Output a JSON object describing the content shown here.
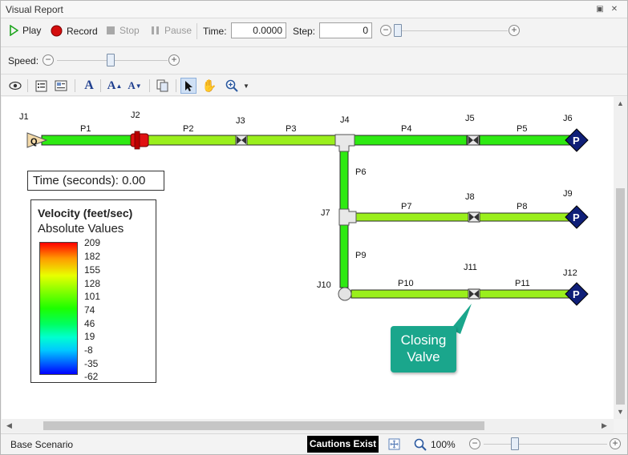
{
  "window": {
    "title": "Visual Report"
  },
  "playback": {
    "play_label": "Play",
    "record_label": "Record",
    "stop_label": "Stop",
    "pause_label": "Pause",
    "time_label": "Time:",
    "time_value": "0.0000",
    "step_label": "Step:",
    "step_value": "0",
    "speed_label": "Speed:",
    "step_slider_level": 0.0,
    "speed_slider_level": 0.5
  },
  "toolbar": {
    "icons": [
      "eye-icon",
      "list-icon",
      "card-icon",
      "font-icon",
      "font-grow-icon",
      "font-shrink-icon",
      "copy-icon",
      "pointer-icon",
      "pan-hand-icon",
      "zoom-icon",
      "dropdown-arrow-icon"
    ],
    "font_glyph": "A"
  },
  "diagram": {
    "junctions": [
      "J1",
      "J2",
      "J3",
      "J4",
      "J5",
      "J6",
      "J7",
      "J8",
      "J9",
      "J10",
      "J11",
      "J12"
    ],
    "pipes": [
      "P1",
      "P2",
      "P3",
      "P4",
      "P5",
      "P6",
      "P7",
      "P8",
      "P9",
      "P10",
      "P11"
    ],
    "source_symbol": "Q",
    "pressure_symbol": "P",
    "time_text": "Time (seconds): 0.00",
    "legend": {
      "title": "Velocity (feet/sec)",
      "subtitle": "Absolute Values",
      "values": [
        "209",
        "182",
        "155",
        "128",
        "101",
        "74",
        "46",
        "19",
        "-8",
        "-35",
        "-62"
      ]
    },
    "callout_text": [
      "Closing",
      "Valve"
    ],
    "colors": {
      "pipe_green": "#2eea12",
      "pipe_light": "#9aef1c",
      "pipe_red": "#e01212",
      "pressure_node": "#0f1f78",
      "callout": "#1aa68c"
    }
  },
  "status": {
    "scenario": "Base Scenario",
    "cautions": "Cautions Exist",
    "zoom": "100%"
  }
}
